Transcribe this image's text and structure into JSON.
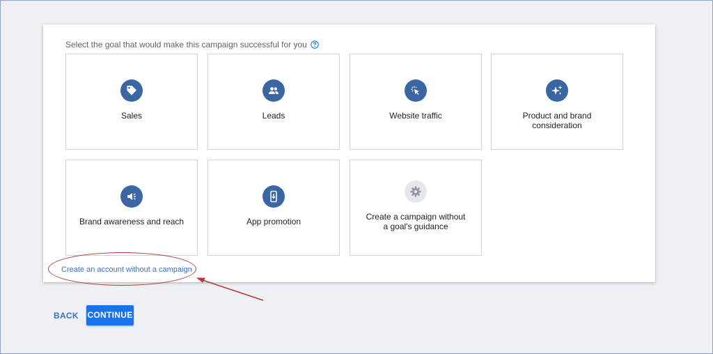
{
  "prompt": "Select the goal that would make this campaign successful for you",
  "goals": [
    {
      "label": "Sales",
      "icon": "tag-icon"
    },
    {
      "label": "Leads",
      "icon": "people-icon"
    },
    {
      "label": "Website traffic",
      "icon": "cursor-click-icon"
    },
    {
      "label": "Product and brand consideration",
      "icon": "sparkle-icon"
    },
    {
      "label": "Brand awareness and reach",
      "icon": "megaphone-icon"
    },
    {
      "label": "App promotion",
      "icon": "phone-download-icon"
    },
    {
      "label": "Create a campaign without a goal's guidance",
      "icon": "gear-icon"
    }
  ],
  "link_text": "Create an account without a campaign",
  "back_label": "BACK",
  "continue_label": "CONTINUE",
  "colors": {
    "icon_bg": "#3a67a4",
    "primary_button": "#1a73e8",
    "link": "#3c70c4",
    "annotation": "#b23a3a"
  }
}
